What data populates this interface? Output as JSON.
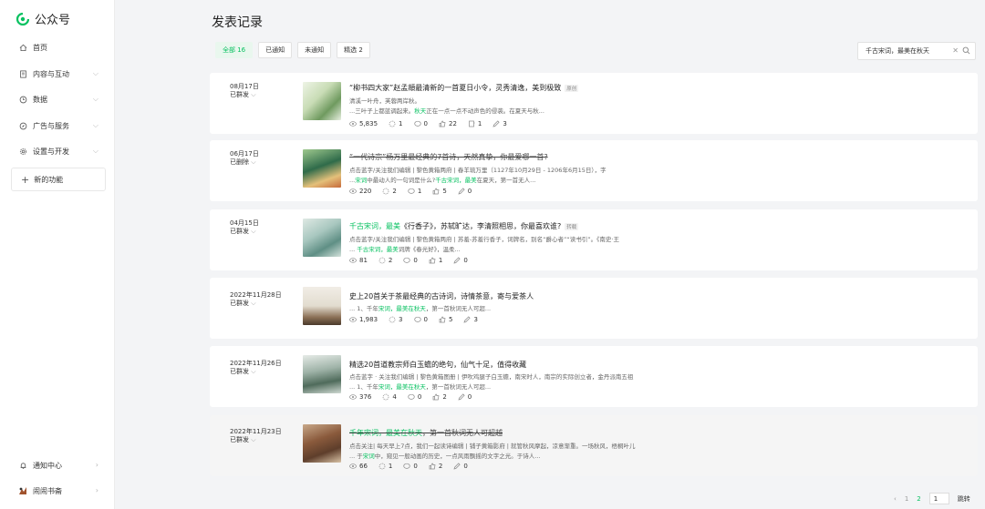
{
  "app": {
    "title": "公众号"
  },
  "sidebar": {
    "items": [
      {
        "label": "首页",
        "icon": "home-icon",
        "expandable": false
      },
      {
        "label": "内容与互动",
        "icon": "document-icon",
        "expandable": true
      },
      {
        "label": "数据",
        "icon": "clock-icon",
        "expandable": true
      },
      {
        "label": "广告与服务",
        "icon": "compass-icon",
        "expandable": true
      },
      {
        "label": "设置与开发",
        "icon": "gear-icon",
        "expandable": true
      }
    ],
    "new_feature": "新的功能",
    "bottom": [
      {
        "label": "通知中心",
        "icon": "bell-icon"
      },
      {
        "label": "闹闹书斋",
        "icon": "avatar"
      }
    ]
  },
  "main": {
    "title": "发表记录",
    "tabs": [
      {
        "label": "全部 16",
        "active": true
      },
      {
        "label": "已通知",
        "active": false
      },
      {
        "label": "未通知",
        "active": false
      },
      {
        "label": "精选 2",
        "active": false
      }
    ],
    "search": {
      "value": "千古宋词，最美在秋天"
    }
  },
  "records": [
    {
      "date": "08月17日",
      "state": "已群发",
      "title": "“柳书四大家”赵孟頫最清新的一首夏日小令，灵秀清逸，美到极致",
      "tag": "原创",
      "line1": "清溪一叶舟，芙蓉两岸秋。",
      "line2_pre": "...三叶子上都蓝调起来。",
      "line2_hi": "秋天",
      "line2_post": "正在一点一点不动声色的侵袭。在夏天与秋...",
      "stats": {
        "reads": "5,835",
        "shares": "1",
        "comments": "0",
        "likes": "22",
        "saves": "1",
        "edits": "3"
      }
    },
    {
      "date": "06月17日",
      "state": "已删除",
      "title": "“一代诗宗”杨万里最经典的7首诗，天然真挚，你最爱哪一首?",
      "strike": true,
      "line1": "点击蓝字/关注我们编辑 | 黎色黄箱两府 | 春羊琉万里（1127年10月29日 - 1206年6月15日），字",
      "line2_pre": "...",
      "line2_hi": "宋词",
      "line2_mid": "中最动人的一句词是什么?",
      "line2_hi2": "千古宋词，最美",
      "line2_post": "在夏天，第一首无人...",
      "stats": {
        "reads": "220",
        "shares": "2",
        "comments": "1",
        "likes": "5",
        "edits": "0"
      }
    },
    {
      "date": "04月15日",
      "state": "已群发",
      "title_hi": "千古宋词，最美",
      "title_rest": "《行香子》，苏轼旷达，李清照相思，你最喜欢谁?",
      "tag": "转载",
      "line1": "点击蓝字/关注我们编辑 | 黎色黄箱两府 | 苏羞-苏羞行香子，词牌名，别名“爵心者”“读书引”。《南史·王",
      "line2_pre": "... ",
      "line2_hi": "千古宋词，最美",
      "line2_post": "词牌《春光好》，温柔...",
      "stats": {
        "reads": "81",
        "shares": "2",
        "comments": "0",
        "likes": "1",
        "edits": "0"
      }
    },
    {
      "date": "2022年11月28日",
      "state": "已群发",
      "title": "史上20首关于茶最经典的古诗词，诗情茶意，寄与爱茶人",
      "line1_pre": "... 1、千年",
      "line1_hi": "宋词，最美在秋天",
      "line1_post": "，第一首秋词无人可超...",
      "stats": {
        "reads": "1,983",
        "shares": "3",
        "comments": "0",
        "likes": "5",
        "edits": "3"
      }
    },
    {
      "date": "2022年11月26日",
      "state": "已群发",
      "title": "精选20首道教宗师白玉蟾的绝句，仙气十足，值得收藏",
      "line1": "点击蓝字 · 关注我们编辑 | 黎色黄箱图册 | 伊吹鸡腿子白玉蟾，南宋时人，南宗的实际创立者，金丹派南五祖",
      "line2_pre": "... 1、千年",
      "line2_hi": "宋词，最美在秋天",
      "line2_post": "，第一首秋词无人可超...",
      "stats": {
        "reads": "376",
        "shares": "4",
        "comments": "0",
        "likes": "2",
        "edits": "0"
      }
    },
    {
      "date": "2022年11月23日",
      "state": "已群发",
      "title_hi": "千年宋词，最美在秋天",
      "title_rest": "，第一首秋词无人可超越",
      "strike": true,
      "line1": "点击关注| 每天早上7点，我们一起读诗编辑 | 铺子黄箱影府 | 就管秋风摩起，凉意渐重。一场秋风，梧桐叶儿",
      "line2_pre": "... 于",
      "line2_hi": "宋词",
      "line2_post": "中，窥见一般动画的历史，一点风雨飘摇的文字之光。于诗人...",
      "stats": {
        "reads": "66",
        "shares": "1",
        "comments": "0",
        "likes": "2",
        "edits": "0"
      }
    }
  ],
  "pagination": {
    "prev": "‹",
    "page1": "1",
    "page2": "2",
    "input": "1",
    "jump": "跳转"
  },
  "colors": {
    "accent": "#07c160"
  }
}
